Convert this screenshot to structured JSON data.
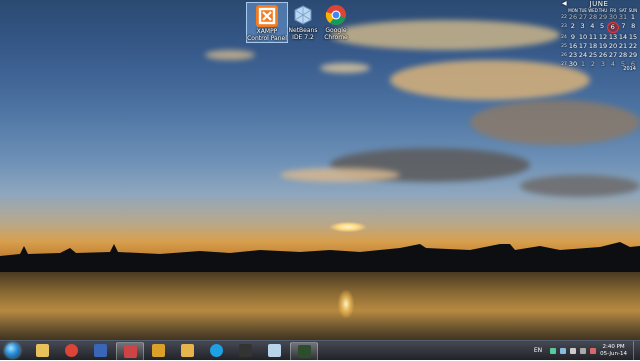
{
  "desktop_icons": [
    {
      "label": "XAMPP Control Panel",
      "icon": "xampp-icon",
      "selected": true
    },
    {
      "label": "NetBeans IDE 7.2",
      "icon": "netbeans-icon",
      "selected": false
    },
    {
      "label": "Google Chrome",
      "icon": "chrome-icon",
      "selected": false
    }
  ],
  "calendar": {
    "month": "JUNE",
    "year": "2014",
    "days_of_week": [
      "MON",
      "TUE",
      "WED",
      "THU",
      "FRI",
      "SAT",
      "SUN"
    ],
    "weeks": [
      {
        "num": "22",
        "days": [
          "26",
          "27",
          "28",
          "29",
          "30",
          "31",
          "1"
        ]
      },
      {
        "num": "23",
        "days": [
          "2",
          "3",
          "4",
          "5",
          "6",
          "7",
          "8"
        ]
      },
      {
        "num": "24",
        "days": [
          "9",
          "10",
          "11",
          "12",
          "13",
          "14",
          "15"
        ]
      },
      {
        "num": "25",
        "days": [
          "16",
          "17",
          "18",
          "19",
          "20",
          "21",
          "22"
        ]
      },
      {
        "num": "26",
        "days": [
          "23",
          "24",
          "25",
          "26",
          "27",
          "28",
          "29"
        ]
      },
      {
        "num": "27",
        "days": [
          "30",
          "1",
          "2",
          "3",
          "4",
          "5",
          "6"
        ]
      }
    ],
    "today": "6"
  },
  "taskbar": {
    "apps": [
      {
        "name": "windows-explorer",
        "icon": "folder-icon"
      },
      {
        "name": "google-chrome",
        "icon": "chrome-icon"
      },
      {
        "name": "save-app",
        "icon": "floppy-icon"
      },
      {
        "name": "media-app",
        "icon": "media-icon"
      },
      {
        "name": "movie-maker",
        "icon": "film-icon"
      },
      {
        "name": "paint",
        "icon": "paint-icon"
      },
      {
        "name": "skype",
        "icon": "skype-icon"
      },
      {
        "name": "screen-recorder",
        "icon": "recorder-icon"
      },
      {
        "name": "notepad",
        "icon": "notepad-icon"
      },
      {
        "name": "camtasia",
        "icon": "camtasia-icon"
      }
    ],
    "language": "EN",
    "clock_time": "2:40 PM",
    "clock_date": "05-Jun-14"
  }
}
